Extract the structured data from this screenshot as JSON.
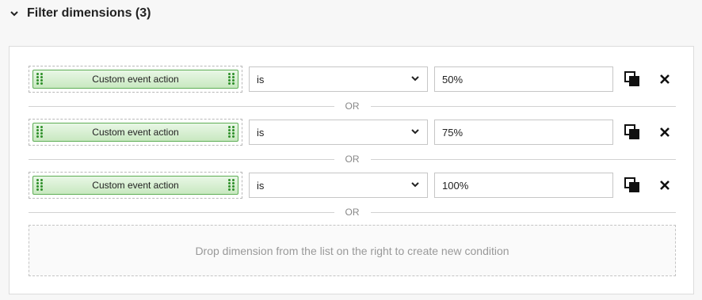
{
  "section": {
    "title": "Filter dimensions (3)",
    "toggle_icon": "chevron-down-icon"
  },
  "conditions": [
    {
      "dimension": "Custom event action",
      "operator": "is",
      "value": "50%"
    },
    {
      "dimension": "Custom event action",
      "operator": "is",
      "value": "75%"
    },
    {
      "dimension": "Custom event action",
      "operator": "is",
      "value": "100%"
    }
  ],
  "separator": "OR",
  "dropzone": {
    "text": "Drop dimension from the list on the right to create new condition"
  },
  "icons": {
    "copy": "copy-icon",
    "remove": "close-icon",
    "grip": "drag-handle-icon"
  },
  "colors": {
    "chip_border": "#5eae55",
    "chip_fill": "#d5eecf",
    "grip": "#2f8f2a"
  }
}
